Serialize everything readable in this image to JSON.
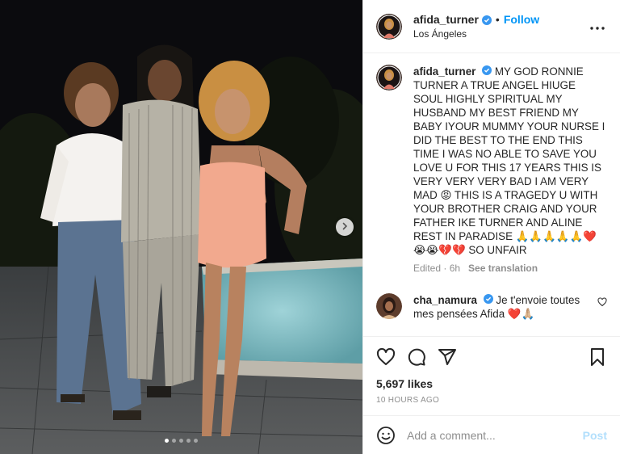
{
  "post": {
    "author": {
      "username": "afida_turner",
      "verified": true,
      "follow_label": "Follow",
      "location": "Los Ángeles"
    },
    "caption": {
      "username": "afida_turner",
      "text": "MY GOD RONNIE TURNER A TRUE ANGEL HIUGE SOUL HIGHLY SPIRITUAL MY HUSBAND MY BEST FRIEND MY BABY IYOUR MUMMY YOUR NURSE I DID THE BEST TO THE END THIS TIME I WAS NO ABLE TO SAVE YOU LOVE U FOR THIS 17 YEARS THIS IS VERY VERY VERY BAD I AM VERY MAD 😡 THIS IS A TRAGEDY U WITH YOUR BROTHER CRAIG AND YOUR FATHER IKE TURNER AND ALINE REST IN PARADISE 🙏🙏🙏🙏🙏❤️😭😭💔💔 SO UNFAIR",
      "edited": "Edited · 6h",
      "see_translation": "See translation"
    },
    "comments": [
      {
        "username": "cha_namura",
        "verified": true,
        "text": "Je t'envoie toutes mes pensées Afida ❤️🙏🏼"
      }
    ],
    "likes": "5,697 likes",
    "time_ago": "10 HOURS AGO",
    "comment_placeholder": "Add a comment...",
    "post_label": "Post",
    "carousel": {
      "count": 5,
      "active": 0
    },
    "icons": {
      "more": "more-options-icon",
      "like": "heart-icon",
      "comment": "comment-icon",
      "share": "share-icon",
      "save": "bookmark-icon",
      "emoji": "emoji-icon",
      "next": "chevron-right-icon"
    },
    "colors": {
      "link": "#0095f6",
      "muted": "#8e8e8e",
      "post_disabled": "#b2dffc"
    }
  }
}
